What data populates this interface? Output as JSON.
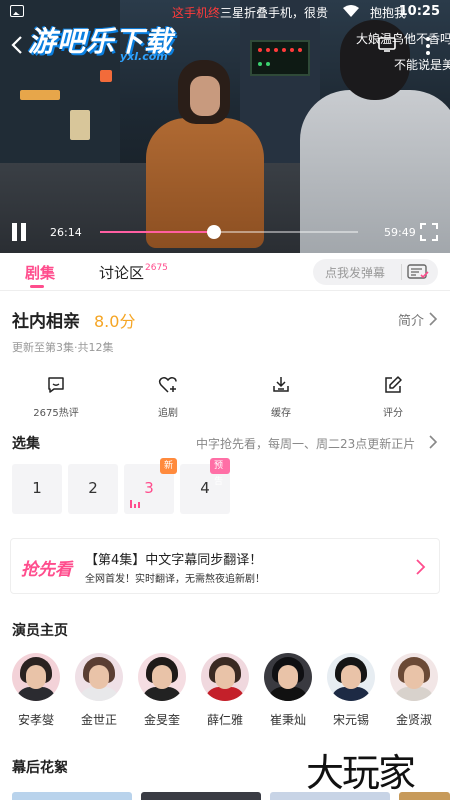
{
  "status_bar": {
    "marquee_red": "这手机终",
    "marquee_rest": "三星折叠手机，很贵",
    "aux": "抱抱我",
    "time": "10:25"
  },
  "video": {
    "logo_main": "游吧乐下载",
    "logo_sub": "yxl.com",
    "danmaku": [
      "大娘温鸟他不香吗",
      "不能说是美"
    ],
    "current_time": "26:14",
    "total_time": "59:49",
    "progress": 0.44
  },
  "tabs": {
    "episodes": "剧集",
    "discussion": "讨论区",
    "discussion_count": "2675",
    "danmu_placeholder": "点我发弹幕"
  },
  "show": {
    "title": "社内相亲",
    "score": "8.0分",
    "intro": "简介",
    "update": "更新至第3集·共12集"
  },
  "actions": [
    {
      "label": "2675热评",
      "icon": "comment-icon"
    },
    {
      "label": "追剧",
      "icon": "heart-plus-icon"
    },
    {
      "label": "缓存",
      "icon": "download-icon"
    },
    {
      "label": "评分",
      "icon": "edit-icon"
    }
  ],
  "episode_section": {
    "title": "选集",
    "note": "中字抢先看，每周一、周二23点更新正片",
    "episodes": [
      {
        "num": "1"
      },
      {
        "num": "2"
      },
      {
        "num": "3",
        "badge": "新"
      },
      {
        "num": "4",
        "badge": "预告"
      }
    ]
  },
  "banner": {
    "tag": "抢先看",
    "title": "【第4集】中文字幕同步翻译！",
    "subtitle": "全网首发！实时翻译，无需熬夜追新剧！"
  },
  "cast": {
    "title": "演员主页",
    "members": [
      "安孝燮",
      "金世正",
      "金旻奎",
      "薛仁雅",
      "崔秉灿",
      "宋元锡",
      "金贤淑"
    ]
  },
  "behind": {
    "title": "幕后花絮"
  },
  "watermark": "大玩家",
  "colors": {
    "accent": "#ff4d8d",
    "score": "#f5a524",
    "badge_new": "#ff8a3d"
  }
}
